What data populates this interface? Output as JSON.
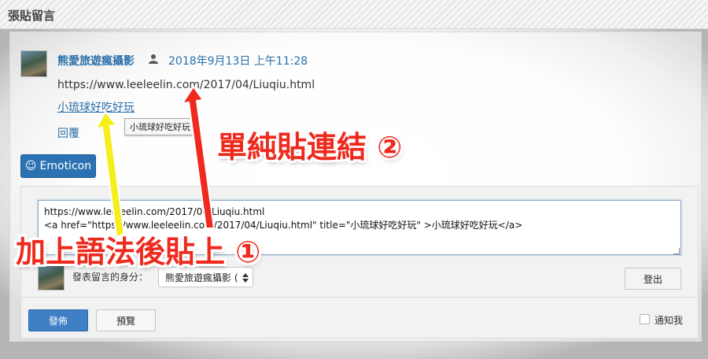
{
  "header": {
    "title": "張貼留言"
  },
  "comment": {
    "author": "熊愛旅遊瘋攝影",
    "date": "2018年9月13日 上午11:28",
    "url_text": "https://www.leeleelin.com/2017/04/Liuqiu.html",
    "link_text": "小琉球好吃好玩",
    "tooltip": "小琉球好吃好玩",
    "reply_label": "回覆"
  },
  "emoticon": {
    "label": "Emoticon",
    "icon": "smiley-icon"
  },
  "form": {
    "textarea_value": "https://www.leeleelin.com/2017/04/Liuqiu.html\n<a href=\"https://www.leeleelin.com/2017/04/Liuqiu.html\" title=\"小琉球好吃好玩\" >小琉球好吃好玩</a>",
    "identity_label": "發表留言的身分：",
    "identity_selected": "熊愛旅遊瘋攝影 (",
    "logout_label": "登出",
    "publish_label": "發佈",
    "preview_label": "預覽",
    "notify_label": "通知我"
  },
  "annotations": {
    "note_2": "單純貼連結 ②",
    "note_1": "加上語法後貼上 ①",
    "colors": {
      "red": "#ee2a1e",
      "yellow": "#f5ee1a"
    }
  }
}
